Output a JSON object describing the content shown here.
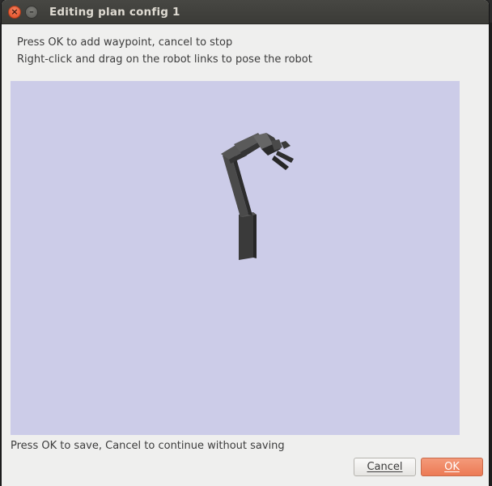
{
  "window": {
    "title": "Editing plan config 1",
    "close_glyph": "×",
    "minimize_glyph": "–"
  },
  "instructions": {
    "line1": "Press OK to add waypoint, cancel to stop",
    "line2": "Right-click and drag on the robot links to pose the robot"
  },
  "viewport": {
    "background_color": "#cccce8",
    "content": "robot-arm-3d-view"
  },
  "footer": {
    "message": "Press OK to save, Cancel to continue without saving"
  },
  "buttons": {
    "cancel_label": "Cancel",
    "ok_label": "OK"
  },
  "colors": {
    "ok_accent": "#ec7a55",
    "close_button": "#df4a20"
  }
}
